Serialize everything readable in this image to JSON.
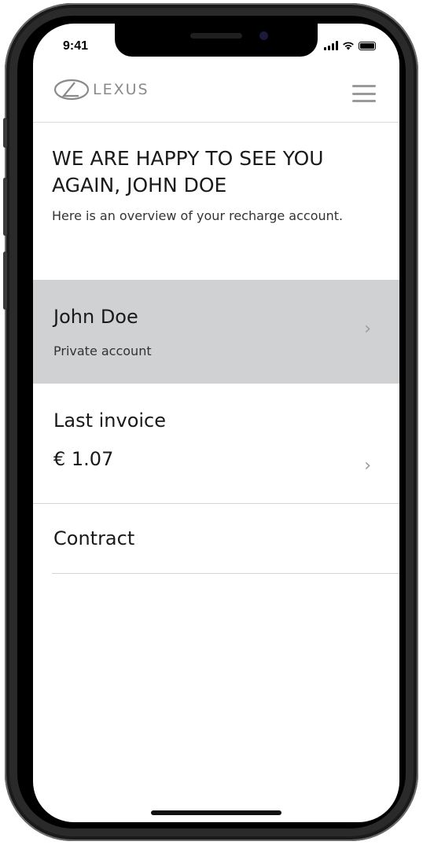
{
  "status_bar": {
    "time": "9:41",
    "signal_icon": "cellular-signal-icon",
    "wifi_icon": "wifi-icon",
    "battery_icon": "battery-icon"
  },
  "header": {
    "brand_text": "LEXUS",
    "logo_icon": "lexus-emblem-icon",
    "menu_icon": "hamburger-menu-icon"
  },
  "welcome": {
    "title": "WE ARE HAPPY TO SEE YOU AGAIN, JOHN DOE",
    "subtitle": "Here is an overview of your recharge account."
  },
  "account": {
    "name": "John Doe",
    "type": "Private account",
    "chevron": "›"
  },
  "invoice": {
    "label": "Last invoice",
    "amount": "€ 1.07",
    "chevron": "›"
  },
  "contract": {
    "label": "Contract"
  },
  "colors": {
    "card_background": "#d0d1d3",
    "divider": "#d4d4d4",
    "brand_gray": "#8a8a8a"
  }
}
